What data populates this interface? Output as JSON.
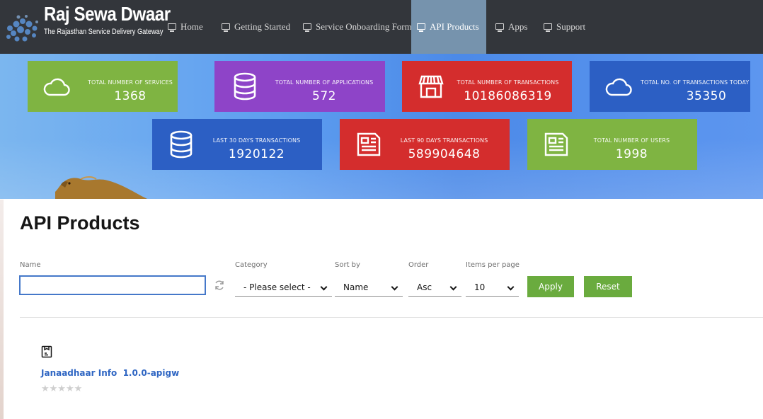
{
  "brand": {
    "title": "Raj Sewa Dwaar",
    "subtitle": "The Rajasthan Service Delivery Gateway"
  },
  "nav": {
    "items": [
      {
        "label": "Home",
        "icon": "monitor-icon",
        "active": false
      },
      {
        "label": "Getting Started",
        "icon": "monitor-icon",
        "active": false
      },
      {
        "label": "Service Onboarding Form",
        "icon": "monitor-icon",
        "active": false
      },
      {
        "label": "API Products",
        "icon": "monitor-icon",
        "active": true
      },
      {
        "label": "Apps",
        "icon": "monitor-icon",
        "active": false
      },
      {
        "label": "Support",
        "icon": "monitor-icon",
        "active": false
      }
    ]
  },
  "stats": [
    {
      "label": "TOTAL NUMBER OF SERVICES",
      "value": "1368",
      "icon": "cloud-icon",
      "color": "#7fb442"
    },
    {
      "label": "TOTAL NUMBER OF APPLICATIONS",
      "value": "572",
      "icon": "database-icon",
      "color": "#8e44c8"
    },
    {
      "label": "TOTAL NUMBER OF TRANSACTIONS",
      "value": "10186086319",
      "icon": "store-icon",
      "color": "#d42d2d"
    },
    {
      "label": "TOTAL NO. OF TRANSACTIONS TODAY",
      "value": "35350",
      "icon": "cloud-icon",
      "color": "#2c5fc4"
    },
    {
      "label": "LAST 30 DAYS TRANSACTIONS",
      "value": "1920122",
      "icon": "database-icon",
      "color": "#2c5fc4"
    },
    {
      "label": "LAST 90 DAYS TRANSACTIONS",
      "value": "589904648",
      "icon": "newspaper-icon",
      "color": "#d42d2d"
    },
    {
      "label": "TOTAL NUMBER OF USERS",
      "value": "1998",
      "icon": "newspaper-icon",
      "color": "#7fb442"
    }
  ],
  "page": {
    "title": "API Products"
  },
  "filters": {
    "name_label": "Name",
    "name_value": "",
    "category_label": "Category",
    "category_value": "- Please select -",
    "sortby_label": "Sort by",
    "sortby_value": "Name",
    "order_label": "Order",
    "order_value": "Asc",
    "items_label": "Items per page",
    "items_value": "10",
    "apply_label": "Apply",
    "reset_label": "Reset"
  },
  "products": [
    {
      "name": "Janaadhaar Info",
      "version": "1.0.0-apigw",
      "rating_stars": "★★★★★",
      "rating": 0,
      "icon": "product-box-icon"
    }
  ],
  "colors": {
    "nav_bg": "#33363b",
    "nav_active": "#7693ad",
    "button_green": "#6aab3e",
    "link_blue": "#2f66c3",
    "input_focus": "#4578c9"
  }
}
